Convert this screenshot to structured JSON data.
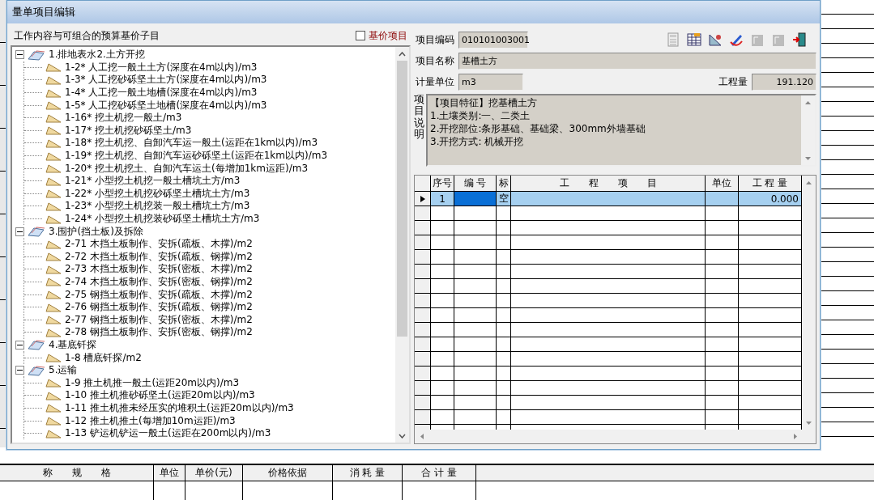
{
  "window": {
    "title": "量单项目编辑"
  },
  "left_panel": {
    "title": "工作内容与可组合的预算基价子目",
    "base_price_checkbox": {
      "label": "基价项目",
      "checked": false
    },
    "tree": [
      {
        "label": "1.排地表水2.土方开挖",
        "expanded": true,
        "children": [
          {
            "label": "1-2* 人工挖一般土土方(深度在4m以内)/m3"
          },
          {
            "label": "1-3* 人工挖砂砾坚土土方(深度在4m以内)/m3"
          },
          {
            "label": "1-4* 人工挖一般土地槽(深度在4m以内)/m3"
          },
          {
            "label": "1-5* 人工挖砂砾坚土地槽(深度在4m以内)/m3"
          },
          {
            "label": "1-16* 挖土机挖一般土/m3"
          },
          {
            "label": "1-17* 挖土机挖砂砾坚土/m3"
          },
          {
            "label": "1-18* 挖土机挖、自卸汽车运一般土(运距在1km以内)/m3"
          },
          {
            "label": "1-19* 挖土机挖、自卸汽车运砂砾坚土(运距在1km以内)/m3"
          },
          {
            "label": "1-20* 挖土机挖土、自卸汽车运土(每增加1km运距)/m3"
          },
          {
            "label": "1-21* 小型挖土机挖一般土槽坑土方/m3"
          },
          {
            "label": "1-22* 小型挖土机挖砂砾坚土槽坑土方/m3"
          },
          {
            "label": "1-23* 小型挖土机挖装一般土槽坑土方/m3"
          },
          {
            "label": "1-24* 小型挖土机挖装砂砾坚土槽坑土方/m3"
          }
        ]
      },
      {
        "label": "3.围护(挡土板)及拆除",
        "expanded": true,
        "children": [
          {
            "label": "2-71 木挡土板制作、安拆(疏板、木撑)/m2"
          },
          {
            "label": "2-72 木挡土板制作、安拆(疏板、钢撑)/m2"
          },
          {
            "label": "2-73 木挡土板制作、安拆(密板、木撑)/m2"
          },
          {
            "label": "2-74 木挡土板制作、安拆(密板、钢撑)/m2"
          },
          {
            "label": "2-75 钢挡土板制作、安拆(疏板、木撑)/m2"
          },
          {
            "label": "2-76 钢挡土板制作、安拆(疏板、钢撑)/m2"
          },
          {
            "label": "2-77 钢挡土板制作、安拆(密板、木撑)/m2"
          },
          {
            "label": "2-78 钢挡土板制作、安拆(密板、钢撑)/m2"
          }
        ]
      },
      {
        "label": "4.基底钎探",
        "expanded": true,
        "children": [
          {
            "label": "1-8 槽底钎探/m2"
          }
        ]
      },
      {
        "label": "5.运输",
        "expanded": true,
        "children": [
          {
            "label": "1-9 推土机推一般土(运距20m以内)/m3"
          },
          {
            "label": "1-10 推土机推砂砾坚土(运距20m以内)/m3"
          },
          {
            "label": "1-11 推土机推未经压实的堆积土(运距20m以内)/m3"
          },
          {
            "label": "1-12 推土机推土(每增加10m运距)/m3"
          },
          {
            "label": "1-13 铲运机铲运一般土(运距在200m以内)/m3"
          }
        ]
      }
    ]
  },
  "right_panel": {
    "code": {
      "label": "项目编码",
      "value": "010101003001"
    },
    "toolbar": [
      {
        "kind": "calculator",
        "disabled": false
      },
      {
        "kind": "table",
        "disabled": false
      },
      {
        "kind": "tools",
        "disabled": false
      },
      {
        "kind": "pen",
        "disabled": false
      },
      {
        "kind": "sheet",
        "disabled": true
      },
      {
        "kind": "sheet-ruler",
        "disabled": true
      },
      {
        "kind": "exit",
        "disabled": false
      }
    ],
    "name": {
      "label": "项目名称",
      "value": "基槽土方"
    },
    "unit": {
      "label": "计量单位",
      "value": "m3"
    },
    "quantity": {
      "label": "工程量",
      "value": "191.120"
    },
    "description": {
      "label": "项目说明",
      "lines": [
        "【项目特征】挖基槽土方",
        "1.土壤类别:一、二类土",
        "2.开挖部位:条形基础、基础梁、300mm外墙基础",
        "3.开挖方式: 机械开挖"
      ]
    },
    "grid": {
      "columns": [
        "序号",
        "编 号",
        "标",
        "工　　程　　项　　目",
        "单位",
        "工 程 量"
      ],
      "rows": [
        {
          "number": "1",
          "mark": "空",
          "quantity": "0.000",
          "selected": true
        }
      ]
    }
  },
  "background_table": {
    "columns": [
      "称　　规　　格",
      "单位",
      "单价(元)",
      "价格依据",
      "消 耗 量",
      "合 计 量"
    ]
  }
}
